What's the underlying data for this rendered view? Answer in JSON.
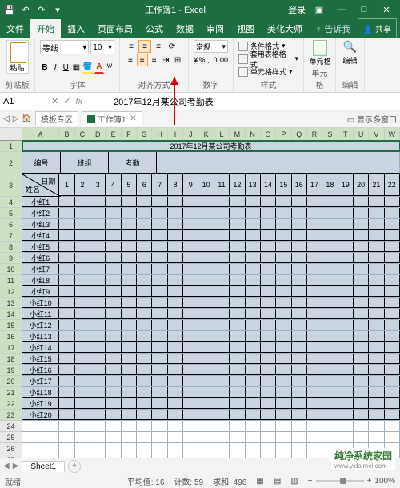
{
  "title": "工作簿1 - Excel",
  "login": "登录",
  "tabs": [
    "文件",
    "开始",
    "插入",
    "页面布局",
    "公式",
    "数据",
    "审阅",
    "视图",
    "美化大师"
  ],
  "help": "告诉我",
  "share": "共享",
  "clipboard_label": "剪贴板",
  "font": {
    "family": "等线",
    "size": "10",
    "label": "字体"
  },
  "align_label": "对齐方式",
  "num": {
    "format": "常规",
    "label": "数字"
  },
  "styles": {
    "cond": "条件格式",
    "table": "套用表格格式",
    "cell": "单元格样式",
    "label": "样式"
  },
  "cellsg": {
    "btn": "单元格",
    "label": "单元格"
  },
  "editg": {
    "btn": "编辑",
    "label": "编辑"
  },
  "namebox": "A1",
  "formula": "2017年12月某公司考勤表",
  "tabbar": {
    "tpl": "模板专区",
    "doc": "工作簿1",
    "multi": "显示多窗口"
  },
  "cols": [
    "A",
    "B",
    "C",
    "D",
    "E",
    "F",
    "G",
    "H",
    "I",
    "J",
    "K",
    "L",
    "M",
    "N",
    "O",
    "P",
    "Q",
    "R",
    "S",
    "T",
    "U",
    "V",
    "W"
  ],
  "sheet_content": {
    "title": "2017年12月某公司考勤表",
    "h_bianhao": "编号",
    "h_banzu": "班组",
    "h_kaoqin": "考勤",
    "h_riqi": "日期",
    "h_xingming": "姓名",
    "days": [
      "1",
      "2",
      "3",
      "4",
      "5",
      "6",
      "7",
      "8",
      "9",
      "10",
      "11",
      "12",
      "13",
      "14",
      "15",
      "16",
      "17",
      "18",
      "19",
      "20",
      "21",
      "22"
    ],
    "names": [
      "小红1",
      "小红2",
      "小红3",
      "小红4",
      "小红5",
      "小红6",
      "小红7",
      "小红8",
      "小红9",
      "小红10",
      "小红11",
      "小红12",
      "小红13",
      "小红14",
      "小红15",
      "小红16",
      "小红17",
      "小红18",
      "小红19",
      "小红20"
    ]
  },
  "sheet_tab": "Sheet1",
  "status": {
    "ready": "就绪",
    "avg": "平均值: 16",
    "count": "计数: 59",
    "sum": "求和: 496",
    "zoom": "100%"
  },
  "watermark": {
    "main": "纯净系统家园",
    "sub": "www.yidaimei.com"
  }
}
